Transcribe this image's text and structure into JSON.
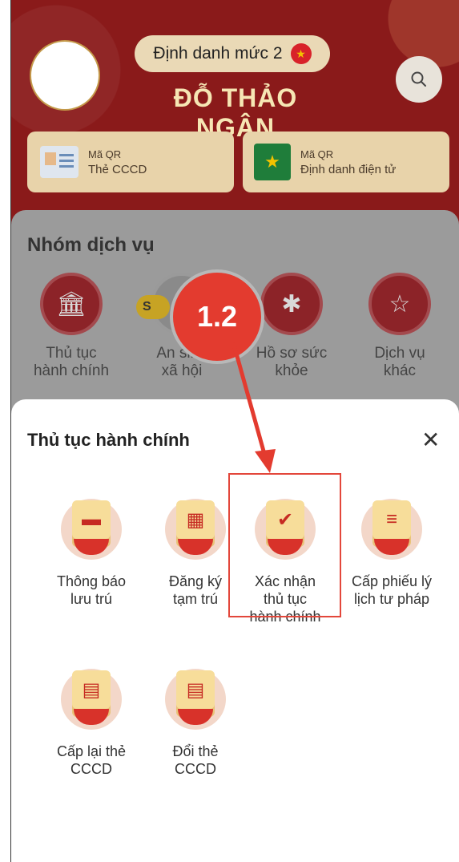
{
  "header": {
    "level_pill": "Định danh mức 2",
    "user_name": "ĐỖ THẢO NGÂN",
    "qr_cards": [
      {
        "line1": "Mã QR",
        "line2": "Thẻ CCCD"
      },
      {
        "line1": "Mã QR",
        "line2": "Định danh điện tử"
      }
    ]
  },
  "services": {
    "title": "Nhóm dịch vụ",
    "items": [
      {
        "label1": "Thủ tục",
        "label2": "hành chính"
      },
      {
        "label1": "An sinh",
        "label2": "xã hội"
      },
      {
        "label1": "Hồ sơ sức",
        "label2": "khỏe"
      },
      {
        "label1": "Dịch vụ",
        "label2": "khác"
      }
    ],
    "badge": "S"
  },
  "callout": "1.2",
  "sheet": {
    "title": "Thủ tục hành chính",
    "close": "✕",
    "items": [
      {
        "label1": "Thông báo",
        "label2": "lưu trú",
        "label3": ""
      },
      {
        "label1": "Đăng ký",
        "label2": "tạm trú",
        "label3": ""
      },
      {
        "label1": "Xác nhận",
        "label2": "thủ tục",
        "label3": "hành chính"
      },
      {
        "label1": "Cấp phiếu lý",
        "label2": "lịch tư pháp",
        "label3": ""
      },
      {
        "label1": "Cấp lại thẻ",
        "label2": "CCCD",
        "label3": ""
      },
      {
        "label1": "Đổi thẻ",
        "label2": "CCCD",
        "label3": ""
      }
    ]
  },
  "colors": {
    "header_bg": "#8a1a1a",
    "accent_red": "#e33b2f",
    "gold_text": "#f6e6b4"
  }
}
